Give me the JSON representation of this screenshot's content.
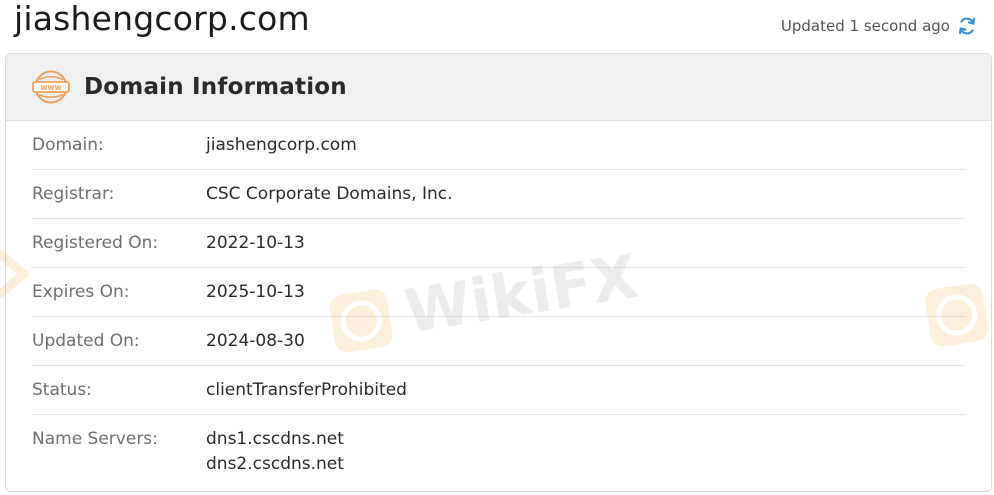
{
  "header": {
    "domain": "jiashengcorp.com",
    "updated_text": "Updated 1 second ago",
    "refresh_icon": "refresh-icon"
  },
  "card": {
    "title": "Domain Information",
    "icon": "www-globe-icon",
    "rows": [
      {
        "label": "Domain:",
        "value": "jiashengcorp.com"
      },
      {
        "label": "Registrar:",
        "value": "CSC Corporate Domains, Inc."
      },
      {
        "label": "Registered On:",
        "value": "2022-10-13"
      },
      {
        "label": "Expires On:",
        "value": "2025-10-13"
      },
      {
        "label": "Updated On:",
        "value": "2024-08-30"
      },
      {
        "label": "Status:",
        "value": "clientTransferProhibited"
      },
      {
        "label": "Name Servers:",
        "values": [
          "dns1.cscdns.net",
          "dns2.cscdns.net"
        ]
      }
    ]
  },
  "watermark": {
    "text": "WikiFX"
  },
  "colors": {
    "accent_orange": "#f0a05a",
    "refresh_blue": "#3b8fd6",
    "header_bg": "#f0f0f0",
    "label_gray": "#6f6f6f"
  }
}
